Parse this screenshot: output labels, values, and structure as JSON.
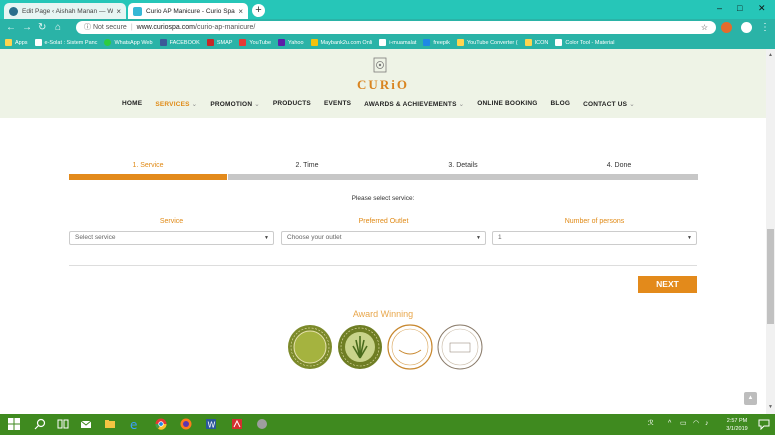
{
  "browser": {
    "tabs": [
      {
        "title": "Edit Page ‹ Aishah Manan — Wo",
        "active": false
      },
      {
        "title": "Curio AP Manicure - Curio Spa",
        "active": true
      }
    ],
    "url_security": "Not secure",
    "url_host": "www.curiospa.com",
    "url_path": "/curio-ap-manicure/",
    "bookmarks": [
      "Apps",
      "e-Solat : Sistem Panc",
      "WhatsApp Web",
      "FACEBOOK",
      "SMAP",
      "YouTube",
      "Yahoo",
      "Maybank2u.com Onli",
      "i-muamalat",
      "freepik",
      "YouTube Converter (",
      "ICON",
      "Color Tool - Material"
    ]
  },
  "site": {
    "logo": "CURiO",
    "nav": [
      {
        "label": "HOME",
        "dropdown": false,
        "active": false
      },
      {
        "label": "SERVICES",
        "dropdown": true,
        "active": true
      },
      {
        "label": "PROMOTION",
        "dropdown": true,
        "active": false
      },
      {
        "label": "PRODUCTS",
        "dropdown": false,
        "active": false
      },
      {
        "label": "EVENTS",
        "dropdown": false,
        "active": false
      },
      {
        "label": "AWARDS & ACHIEVEMENTS",
        "dropdown": true,
        "active": false
      },
      {
        "label": "ONLINE BOOKING",
        "dropdown": false,
        "active": false
      },
      {
        "label": "BLOG",
        "dropdown": false,
        "active": false
      },
      {
        "label": "CONTACT US",
        "dropdown": true,
        "active": false
      }
    ]
  },
  "booking": {
    "steps": [
      "1. Service",
      "2. Time",
      "3. Details",
      "4. Done"
    ],
    "current_step": 1,
    "prompt": "Please select service:",
    "fields": [
      {
        "label": "Service",
        "value": "Select service"
      },
      {
        "label": "Preferred Outlet",
        "value": "Choose your outlet"
      },
      {
        "label": "Number of persons",
        "value": "1"
      }
    ],
    "next_label": "NEXT"
  },
  "awards": {
    "title": "Award Winning"
  },
  "taskbar": {
    "time": "2:57 PM",
    "date": "3/1/2019"
  },
  "colors": {
    "accent": "#e38a1b",
    "chrome": "#26c6b8",
    "header_bg": "#eef3e6",
    "taskbar": "#3f8a1f"
  }
}
